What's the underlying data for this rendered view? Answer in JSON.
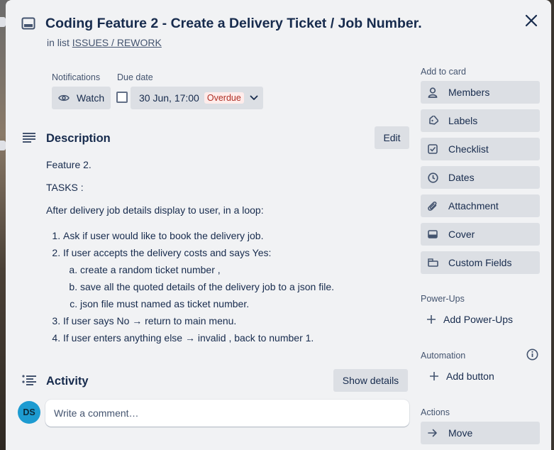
{
  "card": {
    "title": "Coding Feature 2 - Create a Delivery Ticket / Job Number.",
    "in_list_prefix": "in list",
    "list_name": "ISSUES / REWORK"
  },
  "notifications": {
    "label": "Notifications",
    "watch_label": "Watch"
  },
  "due_date": {
    "label": "Due date",
    "value": "30 Jun, 17:00",
    "badge": "Overdue",
    "badge_color": "#ae2e24"
  },
  "description": {
    "title": "Description",
    "edit_label": "Edit",
    "para1": "Feature 2.",
    "para2": "TASKS :",
    "para3": "After delivery job details display to user, in a loop:",
    "items": [
      "Ask if user would like to book the delivery job.",
      "If user accepts the delivery costs and says Yes:",
      "If user says No → return to main menu.",
      "If user enters anything else → invalid , back to number 1."
    ],
    "subitems": [
      "create a random ticket number ,",
      "save all the quoted details of the delivery job to a json file.",
      "json file must named as ticket number."
    ]
  },
  "activity": {
    "title": "Activity",
    "show_details_label": "Show details",
    "avatar_initials": "DS",
    "avatar_color": "#1d9bd1",
    "comment_placeholder": "Write a comment…"
  },
  "sidebar": {
    "add_to_card_label": "Add to card",
    "buttons": [
      {
        "label": "Members",
        "icon": "person-icon"
      },
      {
        "label": "Labels",
        "icon": "tag-icon"
      },
      {
        "label": "Checklist",
        "icon": "checklist-icon"
      },
      {
        "label": "Dates",
        "icon": "clock-icon"
      },
      {
        "label": "Attachment",
        "icon": "paperclip-icon"
      },
      {
        "label": "Cover",
        "icon": "cover-icon"
      },
      {
        "label": "Custom Fields",
        "icon": "custom-fields-icon"
      }
    ],
    "power_ups_label": "Power-Ups",
    "add_power_ups_label": "Add Power-Ups",
    "automation_label": "Automation",
    "add_button_label": "Add button",
    "actions_label": "Actions",
    "move_label": "Move"
  }
}
